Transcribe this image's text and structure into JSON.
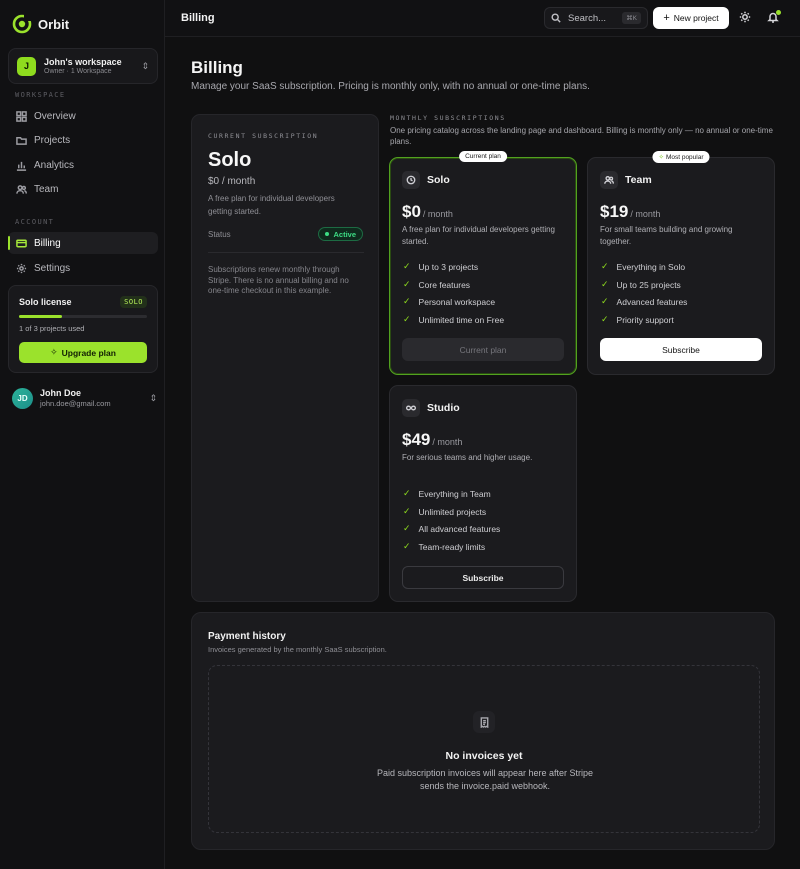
{
  "brand": {
    "name": "Orbit"
  },
  "workspace": {
    "avatar": "J",
    "name": "John's workspace",
    "subtitle": "Owner · 1 Workspace"
  },
  "sidebar": {
    "workspace_label": "WORKSPACE",
    "account_label": "ACCOUNT",
    "items": [
      {
        "label": "Overview",
        "icon": "grid-icon"
      },
      {
        "label": "Projects",
        "icon": "folder-icon"
      },
      {
        "label": "Analytics",
        "icon": "bar-chart-icon"
      },
      {
        "label": "Team",
        "icon": "users-icon"
      },
      {
        "label": "Billing",
        "icon": "card-icon",
        "active": true
      },
      {
        "label": "Settings",
        "icon": "gear-icon"
      }
    ]
  },
  "license": {
    "title": "Solo license",
    "badge": "SOLO",
    "usage_text": "1 of 3 projects used",
    "usage_fraction": 0.333,
    "button": "Upgrade plan"
  },
  "user": {
    "initials": "JD",
    "name": "John Doe",
    "email": "john.doe@gmail.com"
  },
  "topbar": {
    "title": "Billing",
    "search_label": "Search...",
    "search_shortcut": "⌘K",
    "new_project": "New project"
  },
  "page": {
    "title": "Billing",
    "subtitle": "Manage your SaaS subscription. Pricing is monthly only, with no annual or one-time plans."
  },
  "current_subscription": {
    "label": "CURRENT SUBSCRIPTION",
    "plan": "Solo",
    "price": "$0 / month",
    "description": "A free plan for individual developers getting started.",
    "status_label": "Status",
    "status": "Active",
    "note": "Subscriptions renew monthly through Stripe. There is no annual billing and no one-time checkout in this example."
  },
  "monthly": {
    "label": "MONTHLY SUBSCRIPTIONS",
    "description": "One pricing catalog across the landing page and dashboard. Billing is monthly only — no annual or one-time plans."
  },
  "plans": {
    "solo": {
      "tag": "Current plan",
      "name": "Solo",
      "price": "$0",
      "period": "/ month",
      "description": "A free plan for individual developers getting started.",
      "features": [
        "Up to 3 projects",
        "Core features",
        "Personal workspace",
        "Unlimited time on Free"
      ],
      "button": "Current plan"
    },
    "team": {
      "tag": "Most popular",
      "name": "Team",
      "price": "$19",
      "period": "/ month",
      "description": "For small teams building and growing together.",
      "features": [
        "Everything in Solo",
        "Up to 25 projects",
        "Advanced features",
        "Priority support"
      ],
      "button": "Subscribe"
    },
    "studio": {
      "name": "Studio",
      "price": "$49",
      "period": "/ month",
      "description": "For serious teams and higher usage.",
      "features": [
        "Everything in Team",
        "Unlimited projects",
        "All advanced features",
        "Team-ready limits"
      ],
      "button": "Subscribe"
    }
  },
  "history": {
    "title": "Payment history",
    "subtitle": "Invoices generated by the monthly SaaS subscription.",
    "empty_title": "No invoices yet",
    "empty_text": "Paid subscription invoices will appear here after Stripe sends the invoice.paid webhook."
  },
  "colors": {
    "accent": "#9be22c",
    "status_active": "#3ddc84",
    "background": "#101011"
  }
}
